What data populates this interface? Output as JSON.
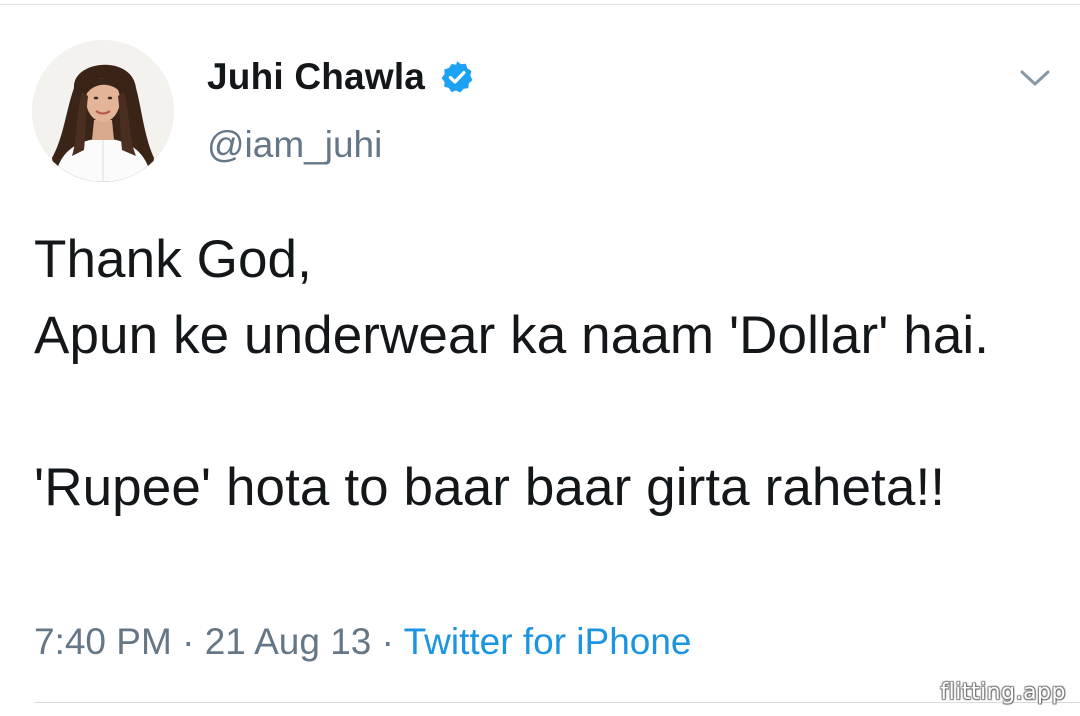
{
  "user": {
    "display_name": "Juhi Chawla",
    "handle": "@iam_juhi",
    "verified": true,
    "avatar_icon": "profile-photo"
  },
  "tweet": {
    "text": "Thank God,\nApun ke underwear ka naam 'Dollar' hai.\n\n'Rupee' hota to baar baar girta raheta!!",
    "time": "7:40 PM",
    "separator": "·",
    "date": "21 Aug 13",
    "source": "Twitter for iPhone"
  },
  "menu_icon": "chevron-down-icon",
  "watermark": "flitting.app",
  "colors": {
    "text_primary": "#14171a",
    "text_secondary": "#657786",
    "link": "#1b95e0",
    "verified_badge": "#1da1f2",
    "divider": "#dde3e8"
  }
}
